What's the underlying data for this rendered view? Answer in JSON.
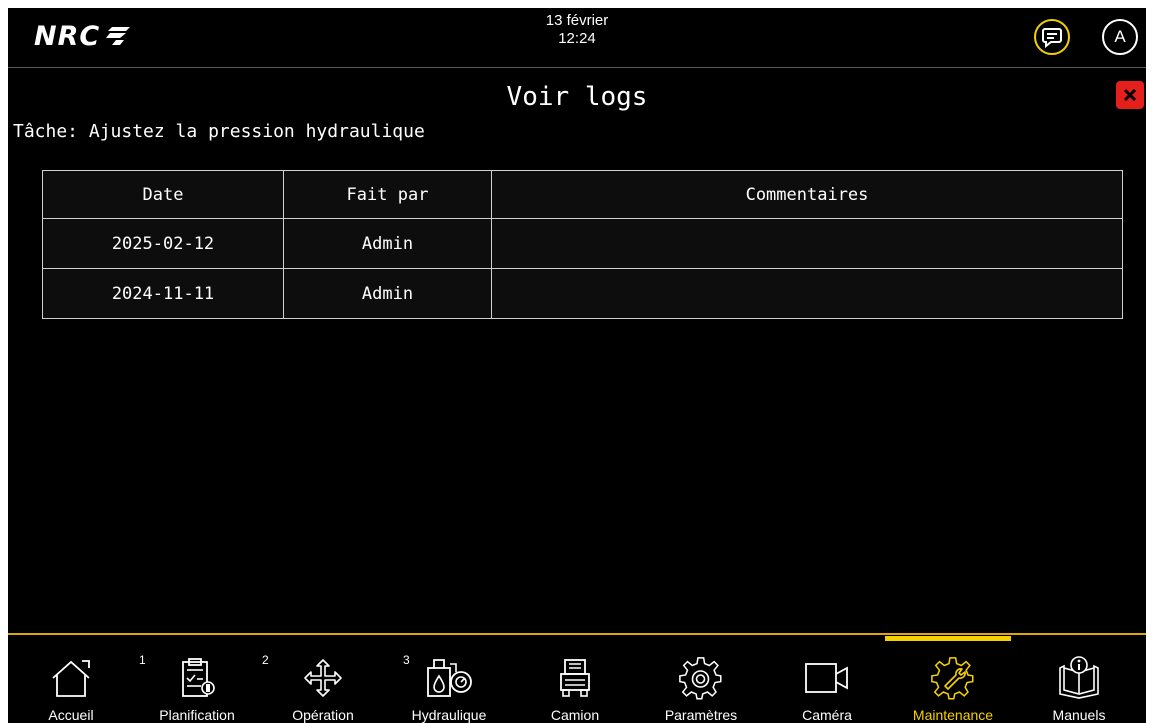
{
  "header": {
    "logo_text": "NRC",
    "date": "13 février",
    "time": "12:24",
    "avatar_letter": "A"
  },
  "page": {
    "title": "Voir logs",
    "task_line": "Tâche: Ajustez la pression hydraulique"
  },
  "table": {
    "columns": [
      "Date",
      "Fait par",
      "Commentaires"
    ],
    "rows": [
      {
        "date": "2025-02-12",
        "by": "Admin",
        "comment": ""
      },
      {
        "date": "2024-11-11",
        "by": "Admin",
        "comment": ""
      }
    ]
  },
  "nav": {
    "items": [
      {
        "label": "Accueil",
        "icon": "home-icon",
        "badge": ""
      },
      {
        "label": "Planification",
        "icon": "clipboard-icon",
        "badge": "1"
      },
      {
        "label": "Opération",
        "icon": "move-arrows-icon",
        "badge": "2"
      },
      {
        "label": "Hydraulique",
        "icon": "hydraulic-icon",
        "badge": "3"
      },
      {
        "label": "Camion",
        "icon": "truck-icon",
        "badge": ""
      },
      {
        "label": "Paramètres",
        "icon": "gear-icon",
        "badge": ""
      },
      {
        "label": "Caméra",
        "icon": "camera-icon",
        "badge": ""
      },
      {
        "label": "Maintenance",
        "icon": "maintenance-gear-icon",
        "badge": ""
      },
      {
        "label": "Manuels",
        "icon": "manual-book-icon",
        "badge": ""
      }
    ],
    "active": "Maintenance"
  },
  "colors": {
    "background": "#000000",
    "accent": "#f5d100",
    "close_button": "#e3201b",
    "text": "#ffffff"
  }
}
